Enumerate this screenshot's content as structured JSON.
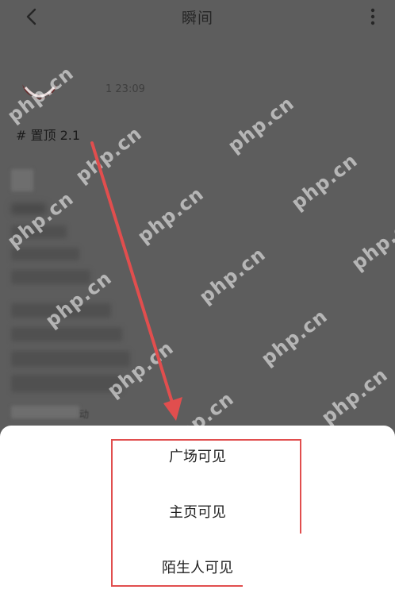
{
  "header": {
    "title": "瞬间",
    "back_icon": "chevron-left-icon",
    "more_icon": "vertical-ellipsis-icon"
  },
  "post": {
    "time": "1 23:09",
    "topic": "# 置顶 2.1",
    "tail_text": "动"
  },
  "watermark": {
    "text": "php.cn"
  },
  "visibility_sheet": {
    "options": [
      {
        "label": "广场可见"
      },
      {
        "label": "主页可见"
      },
      {
        "label": "陌生人可见"
      }
    ]
  },
  "colors": {
    "overlay": "#5d5d5d",
    "sheet": "#ffffff",
    "annotation_red": "#e14e4e"
  }
}
